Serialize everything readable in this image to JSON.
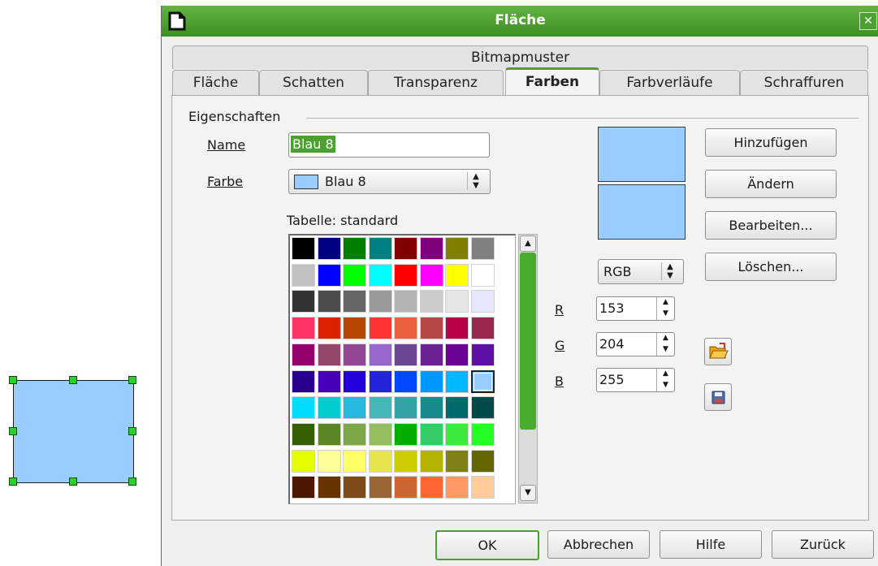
{
  "dialog": {
    "title": "Fläche",
    "close_symbol": "✕"
  },
  "tabs": {
    "top_row": [
      "Bitmapmuster"
    ],
    "bottom_row": [
      "Fläche",
      "Schatten",
      "Transparenz",
      "Farben",
      "Farbverläufe",
      "Schraffuren"
    ],
    "active": "Farben"
  },
  "section": {
    "title": "Eigenschaften"
  },
  "name_field": {
    "label": "Name",
    "value": "Blau 8"
  },
  "color_field": {
    "label": "Farbe",
    "value": "Blau 8",
    "swatch": "#99ccff"
  },
  "table": {
    "label": "Tabelle: standard"
  },
  "palette": [
    [
      "#000000",
      "#000080",
      "#008000",
      "#008080",
      "#800000",
      "#800080",
      "#808000",
      "#808080"
    ],
    [
      "#c0c0c0",
      "#0000ff",
      "#00ff00",
      "#00ffff",
      "#ff0000",
      "#ff00ff",
      "#ffff00",
      "#ffffff"
    ],
    [
      "#333333",
      "#4d4d4d",
      "#666666",
      "#999999",
      "#b3b3b3",
      "#cccccc",
      "#e6e6e6",
      "#e6e6ff"
    ],
    [
      "#ff3366",
      "#dc2300",
      "#b84700",
      "#ff3333",
      "#eb613d",
      "#b84747",
      "#b80047",
      "#99284c"
    ],
    [
      "#94006b",
      "#94476b",
      "#944794",
      "#9966cc",
      "#6b4794",
      "#6b2394",
      "#6b0094",
      "#5e11a6"
    ],
    [
      "#28008c",
      "#4700b8",
      "#2300dc",
      "#2323dc",
      "#0047ff",
      "#0099ff",
      "#00b8ff",
      "#99ccff"
    ],
    [
      "#00dcff",
      "#00cccc",
      "#23b8dc",
      "#47b8b8",
      "#33a3a3",
      "#198a8a",
      "#006b6b",
      "#004a4a"
    ],
    [
      "#355e00",
      "#5c8526",
      "#7da647",
      "#94bd5e",
      "#00ae00",
      "#33cc66",
      "#3deb3d",
      "#23ff23"
    ],
    [
      "#e6ff00",
      "#ffff99",
      "#ffff66",
      "#e6e64c",
      "#cccc00",
      "#b3b300",
      "#808019",
      "#666600"
    ],
    [
      "#4c1900",
      "#663300",
      "#804c19",
      "#996633",
      "#cc6633",
      "#ff6633",
      "#ff9966",
      "#ffcc99"
    ]
  ],
  "selected_cell": {
    "row": 5,
    "col": 7
  },
  "color_model": {
    "value": "RGB"
  },
  "rgb": [
    {
      "label": "R",
      "value": "153"
    },
    {
      "label": "G",
      "value": "204"
    },
    {
      "label": "B",
      "value": "255"
    }
  ],
  "preview_color": "#99ccff",
  "actions": {
    "add": "Hinzufügen",
    "modify": "Ändern",
    "edit": "Bearbeiten...",
    "delete": "Löschen..."
  },
  "icons": {
    "load": "folder-open-icon",
    "save": "save-disk-icon"
  },
  "footer": {
    "ok": "OK",
    "cancel": "Abbrechen",
    "help": "Hilfe",
    "reset": "Zurück"
  },
  "colors": {
    "accent": "#4aa12f",
    "shape_fill": "#99ccff",
    "handle": "#2bd12b"
  }
}
